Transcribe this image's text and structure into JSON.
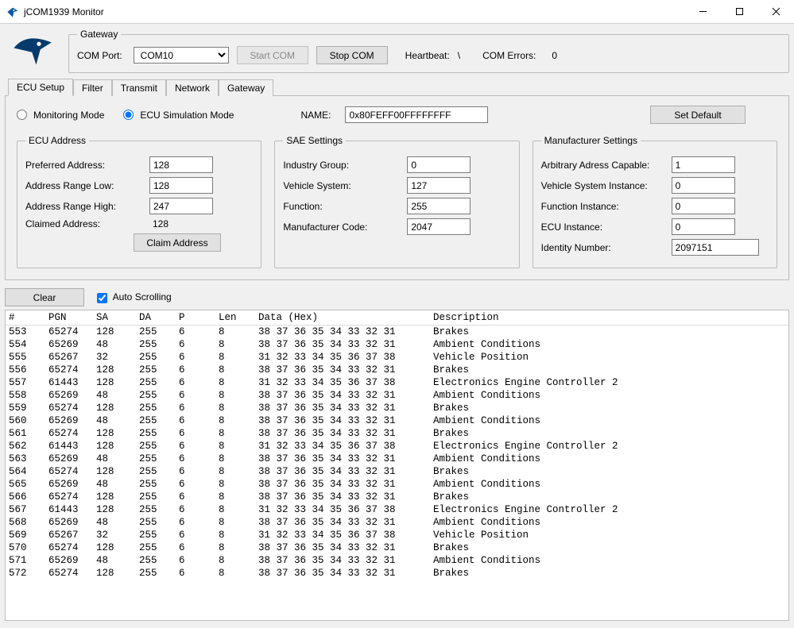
{
  "window": {
    "title": "jCOM1939 Monitor"
  },
  "gateway": {
    "groupLabel": "Gateway",
    "comPortLabel": "COM Port:",
    "comPortValue": "COM10",
    "startBtn": "Start COM",
    "stopBtn": "Stop COM",
    "heartbeatLabel": "Heartbeat:",
    "heartbeatValue": "\\",
    "comErrorsLabel": "COM Errors:",
    "comErrorsValue": "0"
  },
  "tabs": {
    "items": [
      "ECU Setup",
      "Filter",
      "Transmit",
      "Network",
      "Gateway"
    ],
    "activeIndex": 0
  },
  "ecu": {
    "monitoringModeLabel": "Monitoring Mode",
    "simModeLabel": "ECU Simulation Mode",
    "nameLabel": "NAME:",
    "nameValue": "0x80FEFF00FFFFFFFF",
    "setDefaultBtn": "Set Default",
    "addressGroup": "ECU Address",
    "preferredAddrLabel": "Preferred Address:",
    "preferredAddr": "128",
    "rangeLowLabel": "Address Range Low:",
    "rangeLow": "128",
    "rangeHighLabel": "Address Range High:",
    "rangeHigh": "247",
    "claimedLabel": "Claimed Address:",
    "claimed": "128",
    "claimBtn": "Claim Address",
    "saeGroup": "SAE Settings",
    "industryGroupLabel": "Industry Group:",
    "industryGroup": "0",
    "vehicleSystemLabel": "Vehicle System:",
    "vehicleSystem": "127",
    "functionLabel": "Function:",
    "functionVal": "255",
    "mfgCodeLabel": "Manufacturer Code:",
    "mfgCode": "2047",
    "mfgGroup": "Manufacturer Settings",
    "arbAddrLabel": "Arbitrary Adress Capable:",
    "arbAddr": "1",
    "vehSysInstLabel": "Vehicle System Instance:",
    "vehSysInst": "0",
    "funcInstLabel": "Function Instance:",
    "funcInst": "0",
    "ecuInstLabel": "ECU Instance:",
    "ecuInst": "0",
    "identNumLabel": "Identity Number:",
    "identNum": "2097151"
  },
  "log": {
    "clearBtn": "Clear",
    "autoScrollLabel": "Auto Scrolling",
    "columns": [
      "#",
      "PGN",
      "SA",
      "DA",
      "P",
      "Len",
      "Data (Hex)",
      "Description"
    ],
    "rows": [
      {
        "n": "553",
        "pgn": "65274",
        "sa": "128",
        "da": "255",
        "p": "6",
        "len": "8",
        "data": "38 37 36 35 34 33 32 31",
        "desc": "Brakes"
      },
      {
        "n": "554",
        "pgn": "65269",
        "sa": "48",
        "da": "255",
        "p": "6",
        "len": "8",
        "data": "38 37 36 35 34 33 32 31",
        "desc": "Ambient Conditions"
      },
      {
        "n": "555",
        "pgn": "65267",
        "sa": "32",
        "da": "255",
        "p": "6",
        "len": "8",
        "data": "31 32 33 34 35 36 37 38",
        "desc": "Vehicle Position"
      },
      {
        "n": "556",
        "pgn": "65274",
        "sa": "128",
        "da": "255",
        "p": "6",
        "len": "8",
        "data": "38 37 36 35 34 33 32 31",
        "desc": "Brakes"
      },
      {
        "n": "557",
        "pgn": "61443",
        "sa": "128",
        "da": "255",
        "p": "6",
        "len": "8",
        "data": "31 32 33 34 35 36 37 38",
        "desc": "Electronics Engine Controller 2"
      },
      {
        "n": "558",
        "pgn": "65269",
        "sa": "48",
        "da": "255",
        "p": "6",
        "len": "8",
        "data": "38 37 36 35 34 33 32 31",
        "desc": "Ambient Conditions"
      },
      {
        "n": "559",
        "pgn": "65274",
        "sa": "128",
        "da": "255",
        "p": "6",
        "len": "8",
        "data": "38 37 36 35 34 33 32 31",
        "desc": "Brakes"
      },
      {
        "n": "560",
        "pgn": "65269",
        "sa": "48",
        "da": "255",
        "p": "6",
        "len": "8",
        "data": "38 37 36 35 34 33 32 31",
        "desc": "Ambient Conditions"
      },
      {
        "n": "561",
        "pgn": "65274",
        "sa": "128",
        "da": "255",
        "p": "6",
        "len": "8",
        "data": "38 37 36 35 34 33 32 31",
        "desc": "Brakes"
      },
      {
        "n": "562",
        "pgn": "61443",
        "sa": "128",
        "da": "255",
        "p": "6",
        "len": "8",
        "data": "31 32 33 34 35 36 37 38",
        "desc": "Electronics Engine Controller 2"
      },
      {
        "n": "563",
        "pgn": "65269",
        "sa": "48",
        "da": "255",
        "p": "6",
        "len": "8",
        "data": "38 37 36 35 34 33 32 31",
        "desc": "Ambient Conditions"
      },
      {
        "n": "564",
        "pgn": "65274",
        "sa": "128",
        "da": "255",
        "p": "6",
        "len": "8",
        "data": "38 37 36 35 34 33 32 31",
        "desc": "Brakes"
      },
      {
        "n": "565",
        "pgn": "65269",
        "sa": "48",
        "da": "255",
        "p": "6",
        "len": "8",
        "data": "38 37 36 35 34 33 32 31",
        "desc": "Ambient Conditions"
      },
      {
        "n": "566",
        "pgn": "65274",
        "sa": "128",
        "da": "255",
        "p": "6",
        "len": "8",
        "data": "38 37 36 35 34 33 32 31",
        "desc": "Brakes"
      },
      {
        "n": "567",
        "pgn": "61443",
        "sa": "128",
        "da": "255",
        "p": "6",
        "len": "8",
        "data": "31 32 33 34 35 36 37 38",
        "desc": "Electronics Engine Controller 2"
      },
      {
        "n": "568",
        "pgn": "65269",
        "sa": "48",
        "da": "255",
        "p": "6",
        "len": "8",
        "data": "38 37 36 35 34 33 32 31",
        "desc": "Ambient Conditions"
      },
      {
        "n": "569",
        "pgn": "65267",
        "sa": "32",
        "da": "255",
        "p": "6",
        "len": "8",
        "data": "31 32 33 34 35 36 37 38",
        "desc": "Vehicle Position"
      },
      {
        "n": "570",
        "pgn": "65274",
        "sa": "128",
        "da": "255",
        "p": "6",
        "len": "8",
        "data": "38 37 36 35 34 33 32 31",
        "desc": "Brakes"
      },
      {
        "n": "571",
        "pgn": "65269",
        "sa": "48",
        "da": "255",
        "p": "6",
        "len": "8",
        "data": "38 37 36 35 34 33 32 31",
        "desc": "Ambient Conditions"
      },
      {
        "n": "572",
        "pgn": "65274",
        "sa": "128",
        "da": "255",
        "p": "6",
        "len": "8",
        "data": "38 37 36 35 34 33 32 31",
        "desc": "Brakes"
      }
    ]
  }
}
